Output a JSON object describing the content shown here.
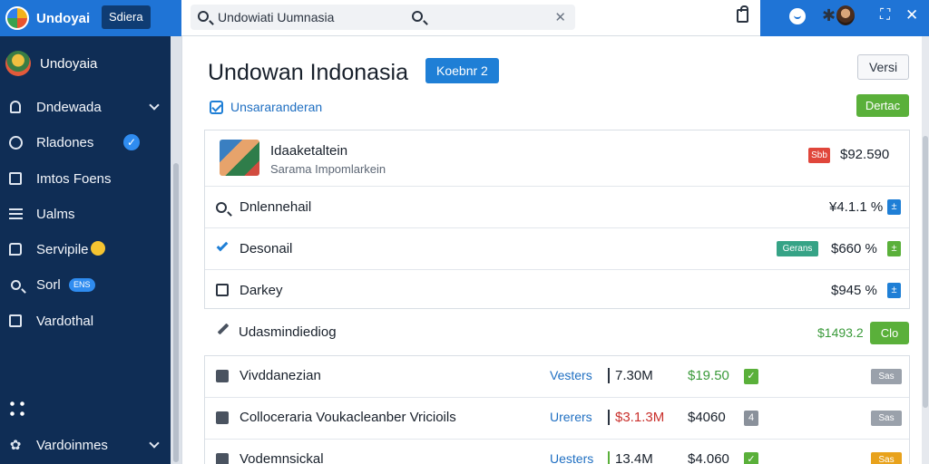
{
  "app": {
    "title": "Undoyai",
    "tag": "Sdiera"
  },
  "search": {
    "value": "Undowiati Uumnasia",
    "clear_glyph": "✕"
  },
  "topbar": {
    "expand_glyph": "⛶",
    "close_glyph": "✕"
  },
  "sidebar": {
    "user": "Undoyaia",
    "items": [
      {
        "label": "Dndewada",
        "icon": "users-icon"
      },
      {
        "label": "Rladones",
        "icon": "clock-icon"
      },
      {
        "label": "Imtos Foens",
        "icon": "document-icon"
      },
      {
        "label": "Ualms",
        "icon": "list-icon"
      },
      {
        "label": "Servipile",
        "icon": "chat-icon"
      },
      {
        "label": "Sorl",
        "icon": "search-icon",
        "badge": "ENS"
      },
      {
        "label": "Vardothal",
        "icon": "panel-icon"
      },
      {
        "label": "Vardoinmes",
        "icon": "settings-icon"
      }
    ]
  },
  "page": {
    "title": "Undowan Indonasia",
    "title_badge": "Koebnr 2",
    "version_button": "Versi",
    "green_button": "Dertac",
    "filter_label": "Unsararanderan"
  },
  "product": {
    "title": "Idaaketaltein",
    "subtitle": "Sarama Impomlarkein",
    "tag": "Sbb",
    "price": "$92.590"
  },
  "items": [
    {
      "label": "Dnlennehail",
      "value": "¥4.1.1 %",
      "mini": "±"
    },
    {
      "label": "Desonail",
      "tag": "Gerans",
      "value": "$660 %",
      "mini": "±"
    },
    {
      "label": "Darkey",
      "value": "$945 %",
      "mini": "±"
    }
  ],
  "section": {
    "title": "Udasmindiediog",
    "value": "$1493.2",
    "button": "Clo"
  },
  "table": [
    {
      "name": "Vivddanezian",
      "status": "Vesters",
      "qty": "7.30M",
      "amount": "$19.50",
      "mini": "✓",
      "mini_color": "#5ab03a",
      "action": "Sas",
      "action_color": "#9aa1ab"
    },
    {
      "name": "Colloceraria Voukacleanber Vricioils",
      "status": "Urerers",
      "qty": "$3.1.3M",
      "amount": "$4060",
      "mini": "4",
      "mini_color": "#8a919b",
      "action": "Sas",
      "action_color": "#9aa1ab"
    },
    {
      "name": "Vodemnsickal",
      "status": "Uesters",
      "qty": "13.4M",
      "amount": "$4.060",
      "mini": "✓",
      "mini_color": "#5ab03a",
      "action": "Sas",
      "action_color": "#e8a21c"
    }
  ],
  "colors": {
    "topbar": "#1f74d6",
    "sidebar": "#0f2d55",
    "accent": "#1f7fd6",
    "success": "#5ab03a",
    "danger": "#e0463b"
  }
}
